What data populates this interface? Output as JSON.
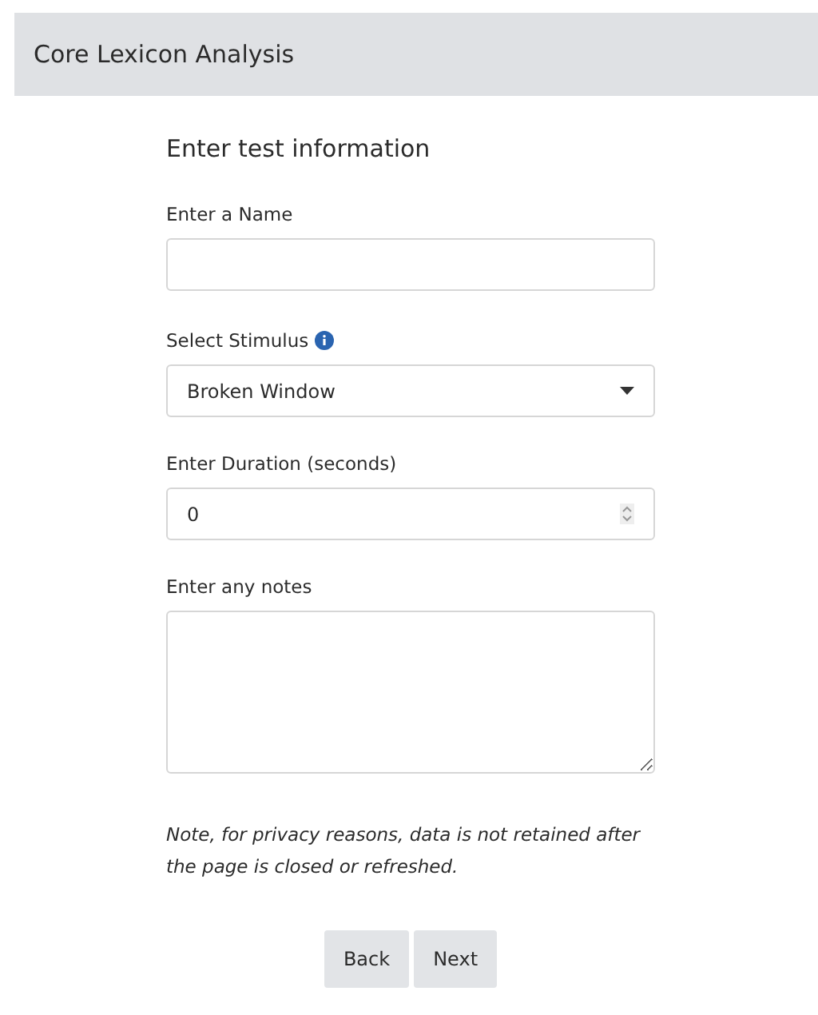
{
  "header": {
    "title": "Core Lexicon Analysis"
  },
  "form": {
    "heading": "Enter test information",
    "fields": [
      {
        "kind": "text",
        "label": "Enter a Name"
      },
      {
        "kind": "select",
        "label": "Select Stimulus",
        "info": true,
        "value": "Broken Window"
      },
      {
        "kind": "number",
        "label": "Enter Duration (seconds)",
        "value": "0"
      },
      {
        "kind": "textarea",
        "label": "Enter any notes"
      }
    ],
    "note": "Note, for privacy reasons, data is not retained after the page is closed or refreshed.",
    "buttons": [
      "Back",
      "Next"
    ]
  }
}
